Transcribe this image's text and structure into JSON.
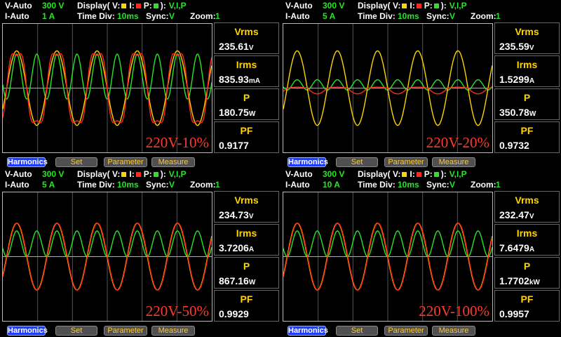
{
  "colors": {
    "voltage": "#ffd400",
    "current": "#ff2a1a",
    "power": "#27e627",
    "label_red": "#ff3a2a",
    "active_button": "#1f3cff"
  },
  "panels": [
    {
      "v_range_label": "V-Auto",
      "v_range_value": "300 V",
      "i_range_label": "I-Auto",
      "i_range_value": "1 A",
      "display_label": "Display( V:",
      "i_legend": "I:",
      "p_legend": "P:",
      "display_close": "):",
      "display_value": "V,I,P",
      "timediv_label": "Time  Div:",
      "timediv_value": "10ms",
      "sync_label": "Sync:",
      "sync_value": "V",
      "zoom_label": "Zoom:",
      "zoom_value": "1",
      "scope_label": "220V-10%",
      "waveform": {
        "v_amp": 0.58,
        "i_amp": 0.62,
        "p_amp": 0.35,
        "p_offset": 0.18,
        "i_shape": "distorted",
        "v_phase": 0
      },
      "measurements": [
        {
          "name": "Vrms",
          "value": "235.61",
          "unit": "V"
        },
        {
          "name": "Irms",
          "value": "835.93",
          "unit": "mA"
        },
        {
          "name": "P",
          "value": "180.75",
          "unit": "W"
        },
        {
          "name": "PF",
          "value": "0.9177",
          "unit": ""
        }
      ],
      "buttons": [
        {
          "label": "Harmonics",
          "active": true
        },
        {
          "label": "Set",
          "active": false
        },
        {
          "label": "Parameter",
          "active": false
        },
        {
          "label": "Measure",
          "active": false
        }
      ]
    },
    {
      "v_range_label": "V-Auto",
      "v_range_value": "300 V",
      "i_range_label": "I-Auto",
      "i_range_value": "5 A",
      "display_label": "Display( V:",
      "i_legend": "I:",
      "p_legend": "P:",
      "display_close": "):",
      "display_value": "V,I,P",
      "timediv_label": "Time  Div:",
      "timediv_value": "10ms",
      "sync_label": "Sync:",
      "sync_value": "V",
      "zoom_label": "Zoom:",
      "zoom_value": "1",
      "scope_label": "220V-20%",
      "waveform": {
        "v_amp": 0.58,
        "i_amp": 0.1,
        "p_amp": 0.08,
        "p_offset": 0.05,
        "i_shape": "small",
        "v_phase": 0
      },
      "measurements": [
        {
          "name": "Vrms",
          "value": "235.59",
          "unit": "V"
        },
        {
          "name": "Irms",
          "value": "1.5299",
          "unit": "A"
        },
        {
          "name": "P",
          "value": "350.78",
          "unit": "W"
        },
        {
          "name": "PF",
          "value": "0.9732",
          "unit": ""
        }
      ],
      "buttons": [
        {
          "label": "Harmonics",
          "active": true
        },
        {
          "label": "Set",
          "active": false
        },
        {
          "label": "Parameter",
          "active": false
        },
        {
          "label": "Measure",
          "active": false
        }
      ]
    },
    {
      "v_range_label": "V-Auto",
      "v_range_value": "300 V",
      "i_range_label": "I-Auto",
      "i_range_value": "5 A",
      "display_label": "Display( V:",
      "i_legend": "I:",
      "p_legend": "P:",
      "display_close": "):",
      "display_value": "V,I,P",
      "timediv_label": "Time  Div:",
      "timediv_value": "10ms",
      "sync_label": "Sync:",
      "sync_value": "V",
      "zoom_label": "Zoom:",
      "zoom_value": "1",
      "scope_label": "220V-50%",
      "waveform": {
        "v_amp": 0.52,
        "i_amp": 0.52,
        "p_amp": 0.2,
        "p_offset": 0.2,
        "i_shape": "clean",
        "v_phase": 0
      },
      "measurements": [
        {
          "name": "Vrms",
          "value": "234.73",
          "unit": "V"
        },
        {
          "name": "Irms",
          "value": "3.7206",
          "unit": "A"
        },
        {
          "name": "P",
          "value": "867.16",
          "unit": "W"
        },
        {
          "name": "PF",
          "value": "0.9929",
          "unit": ""
        }
      ],
      "buttons": [
        {
          "label": "Harmonics",
          "active": true
        },
        {
          "label": "Set",
          "active": false
        },
        {
          "label": "Parameter",
          "active": false
        },
        {
          "label": "Measure",
          "active": false
        }
      ]
    },
    {
      "v_range_label": "V-Auto",
      "v_range_value": "300 V",
      "i_range_label": "I-Auto",
      "i_range_value": "10 A",
      "display_label": "Display( V:",
      "i_legend": "I:",
      "p_legend": "P:",
      "display_close": "):",
      "display_value": "V,I,P",
      "timediv_label": "Time  Div:",
      "timediv_value": "10ms",
      "sync_label": "Sync:",
      "sync_value": "V",
      "zoom_label": "Zoom:",
      "zoom_value": "1",
      "scope_label": "220V-100%",
      "waveform": {
        "v_amp": 0.52,
        "i_amp": 0.52,
        "p_amp": 0.2,
        "p_offset": 0.2,
        "i_shape": "clean",
        "v_phase": 0
      },
      "measurements": [
        {
          "name": "Vrms",
          "value": "232.47",
          "unit": "V"
        },
        {
          "name": "Irms",
          "value": "7.6479",
          "unit": "A"
        },
        {
          "name": "P",
          "value": "1.7702",
          "unit": "kW"
        },
        {
          "name": "PF",
          "value": "0.9957",
          "unit": ""
        }
      ],
      "buttons": [
        {
          "label": "Harmonics",
          "active": true
        },
        {
          "label": "Set",
          "active": false
        },
        {
          "label": "Parameter",
          "active": false
        },
        {
          "label": "Measure",
          "active": false
        }
      ]
    }
  ]
}
